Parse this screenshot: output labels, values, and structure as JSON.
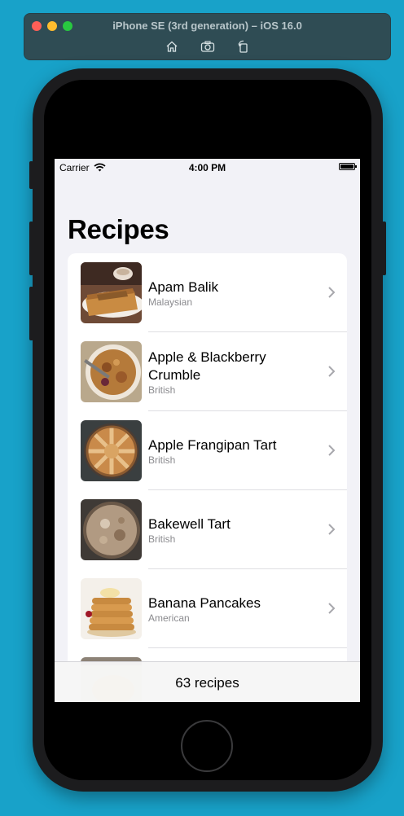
{
  "simulator": {
    "title": "iPhone SE (3rd generation) – iOS 16.0",
    "toolbar_icons": [
      "home-icon",
      "screenshot-icon",
      "rotate-icon"
    ]
  },
  "status_bar": {
    "carrier": "Carrier",
    "time": "4:00 PM"
  },
  "nav": {
    "title": "Recipes"
  },
  "recipes": [
    {
      "name": "Apam Balik",
      "cuisine": "Malaysian"
    },
    {
      "name": "Apple & Blackberry Crumble",
      "cuisine": "British"
    },
    {
      "name": "Apple Frangipan Tart",
      "cuisine": "British"
    },
    {
      "name": "Bakewell Tart",
      "cuisine": "British"
    },
    {
      "name": "Banana Pancakes",
      "cuisine": "American"
    }
  ],
  "toolbar": {
    "count_label": "63 recipes"
  },
  "colors": {
    "desktop": "#18a2c9",
    "screen_background": "#f2f2f7",
    "secondary_text": "#8a8a8e",
    "chevron": "#c4c4c7"
  }
}
